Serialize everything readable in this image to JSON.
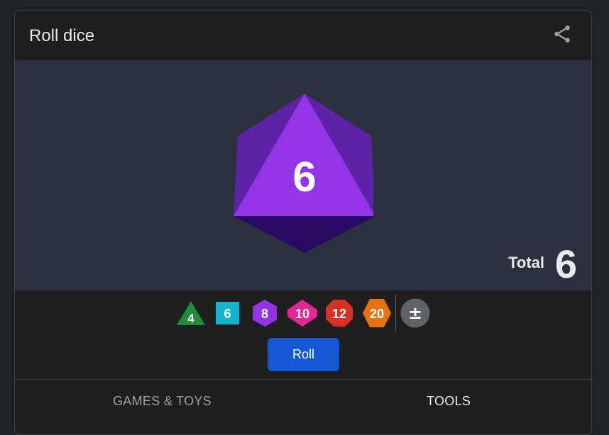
{
  "header": {
    "title": "Roll dice",
    "share_icon": "share-icon"
  },
  "stage": {
    "current_die": "d8",
    "result": "6",
    "die_color": "#9334e6",
    "total_label": "Total",
    "total_value": "6"
  },
  "dice_buttons": [
    {
      "label": "4",
      "color": "#1e8e3e",
      "shape": "triangle"
    },
    {
      "label": "6",
      "color": "#12b5cb",
      "shape": "square"
    },
    {
      "label": "8",
      "color": "#9334e6",
      "shape": "hexagon"
    },
    {
      "label": "10",
      "color": "#e52592",
      "shape": "diamond"
    },
    {
      "label": "12",
      "color": "#d93025",
      "shape": "octagon"
    },
    {
      "label": "20",
      "color": "#e8710a",
      "shape": "hexagon"
    }
  ],
  "modifier_button": {
    "label": "±",
    "color": "#5f6368"
  },
  "roll_button": {
    "label": "Roll"
  },
  "footer_tabs": [
    {
      "label": "GAMES & TOYS"
    },
    {
      "label": "TOOLS"
    }
  ]
}
